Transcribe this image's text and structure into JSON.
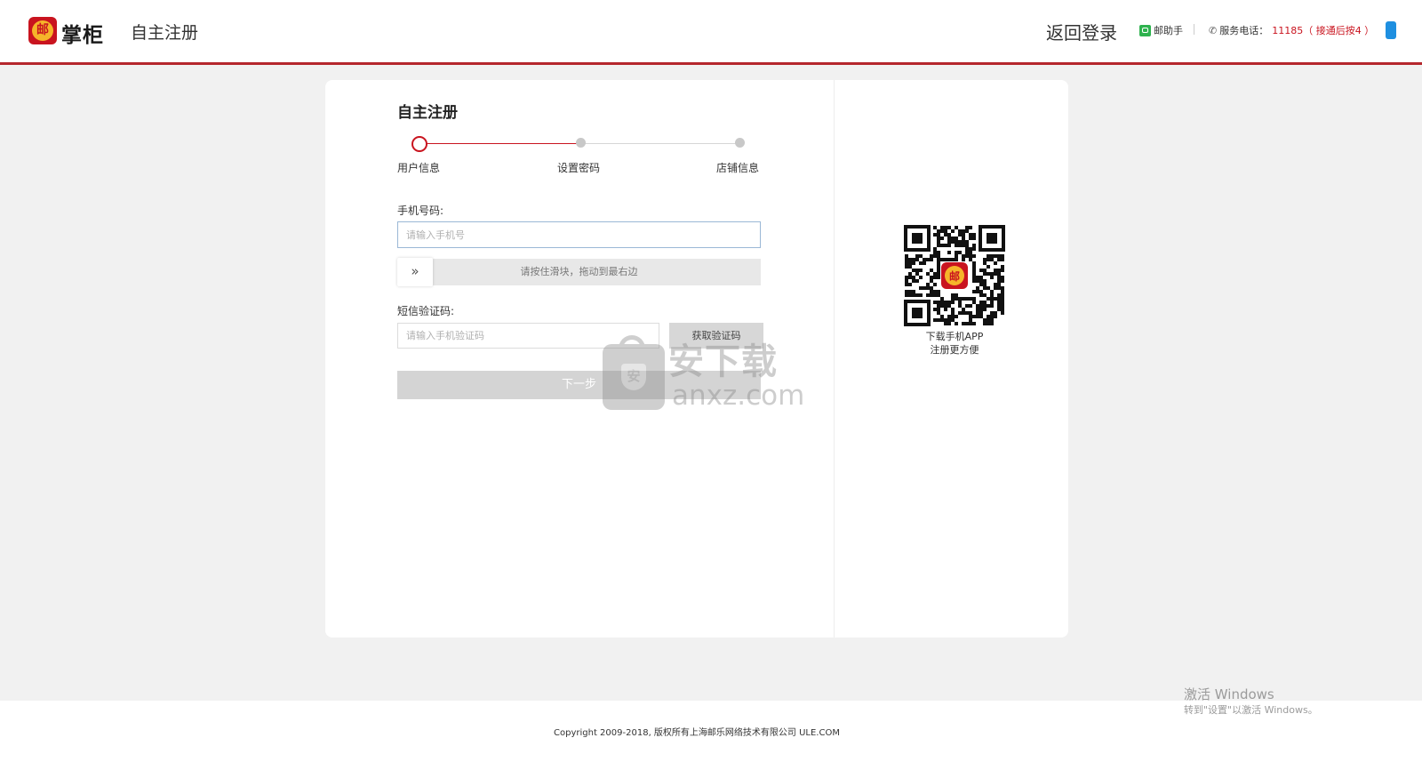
{
  "header": {
    "logo_glyph": "邮",
    "logo_text": "掌柜",
    "title": "自主注册",
    "back_login": "返回登录",
    "assistant": "邮助手",
    "service_label": "服务电话：",
    "service_number": "11185",
    "service_note": "（ 接通后按4 ）",
    "accent_color": "#b5272d"
  },
  "form": {
    "title": "自主注册",
    "steps": [
      {
        "label": "用户信息",
        "active": true
      },
      {
        "label": "设置密码",
        "active": false
      },
      {
        "label": "店铺信息",
        "active": false
      }
    ],
    "phone": {
      "label": "手机号码:",
      "placeholder": "请输入手机号",
      "value": ""
    },
    "slider": {
      "text": "请按住滑块，拖动到最右边",
      "handle_glyph": "»",
      "progress": 0
    },
    "sms": {
      "label": "短信验证码:",
      "placeholder": "请输入手机验证码",
      "value": ""
    },
    "get_code_button": "获取验证码",
    "next_button": "下一步"
  },
  "qr": {
    "center_glyph": "邮",
    "caption_line1": "下载手机APP",
    "caption_line2": "注册更方便"
  },
  "watermark": {
    "bag_glyph": "安",
    "text_cn": "安下载",
    "text_en": "anxz.com"
  },
  "footer": {
    "copyright": "Copyright 2009-2018, 版权所有上海邮乐网络技术有限公司 ULE.COM"
  },
  "os_overlay": {
    "line1": "激活 Windows",
    "line2": "转到\"设置\"以激活 Windows。"
  }
}
